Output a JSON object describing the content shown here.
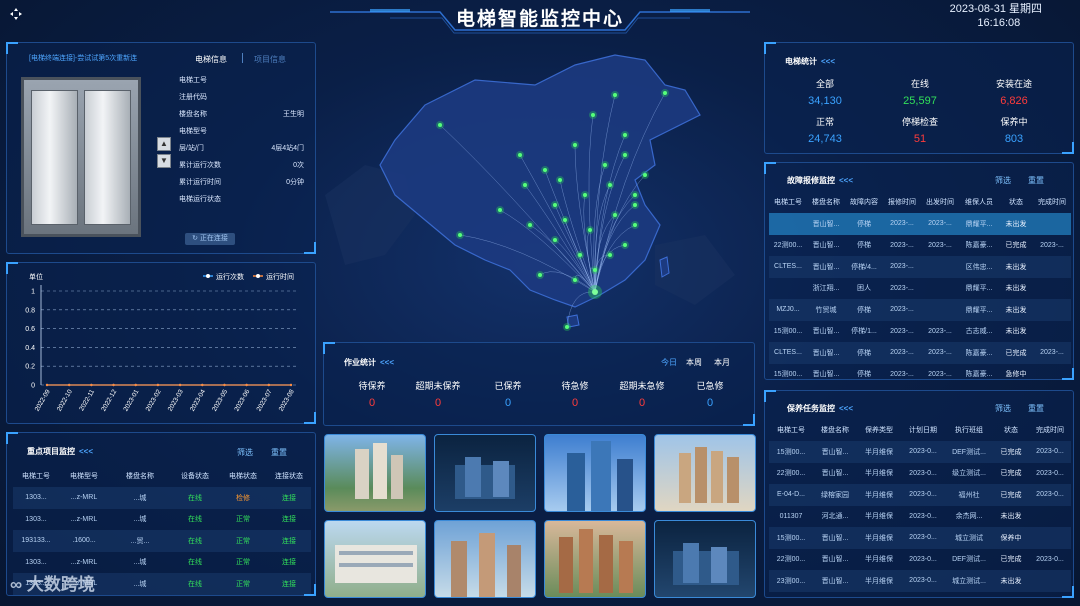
{
  "header": {
    "title": "电梯智能监控中心",
    "date": "2023-08-31 星期四",
    "time": "16:16:08"
  },
  "elevator": {
    "status_msg": "[电梯终端连接]-尝试试第5次重新连",
    "tabs": [
      "电梯信息",
      "项目信息"
    ],
    "fields": [
      {
        "label": "电梯工号",
        "value": ""
      },
      {
        "label": "注册代码",
        "value": ""
      },
      {
        "label": "楼盘名称",
        "value": "王生明"
      },
      {
        "label": "电梯型号",
        "value": ""
      },
      {
        "label": "层/站/门",
        "value": "4层4站4门"
      },
      {
        "label": "累计运行次数",
        "value": "0次"
      },
      {
        "label": "累计运行时间",
        "value": "0分钟"
      },
      {
        "label": "电梯运行状态",
        "value": ""
      }
    ],
    "button": "正在连接"
  },
  "chart_data": {
    "type": "line",
    "ylabel": "单位",
    "categories": [
      "2022-09",
      "2022-10",
      "2022-11",
      "2022-12",
      "2023-01",
      "2023-02",
      "2023-03",
      "2023-04",
      "2023-05",
      "2023-06",
      "2023-07",
      "2023-08"
    ],
    "series": [
      {
        "name": "运行次数",
        "values": [
          0,
          0,
          0,
          0,
          0,
          0,
          0,
          0,
          0,
          0,
          0,
          0
        ],
        "color": "#3aa2ff"
      },
      {
        "name": "运行时间",
        "values": [
          0,
          0,
          0,
          0,
          0,
          0,
          0,
          0,
          0,
          0,
          0,
          0
        ],
        "color": "#ff8a3d"
      }
    ],
    "yticks": [
      0,
      0.2,
      0.4,
      0.6,
      0.8,
      1
    ],
    "ylim": [
      0,
      1
    ]
  },
  "key_projects": {
    "title": "重点项目监控",
    "arrows": "<<<",
    "filter": "筛选",
    "reset": "重置",
    "headers": [
      "电梯工号",
      "电梯型号",
      "楼盘名称",
      "设备状态",
      "电梯状态",
      "连接状态"
    ],
    "rows": [
      [
        "1303...",
        "...z-MRL",
        "...城",
        "在线",
        "检修",
        "连接"
      ],
      [
        "1303...",
        "...z-MRL",
        "...城",
        "在线",
        "正常",
        "连接"
      ],
      [
        "193133...",
        ".1600...",
        "...贸...",
        "在线",
        "正常",
        "连接"
      ],
      [
        "1303...",
        "...z-MRL",
        "...城",
        "在线",
        "正常",
        "连接"
      ],
      [
        "1303...",
        "...z-MRL",
        "...城",
        "在线",
        "正常",
        "连接"
      ]
    ]
  },
  "work_stats": {
    "title": "作业统计",
    "arrows": "<<<",
    "periods": [
      "今日",
      "本周",
      "本月"
    ],
    "items": [
      {
        "label": "待保养",
        "value": "0",
        "color": "#ff3b3b"
      },
      {
        "label": "超期未保养",
        "value": "0",
        "color": "#ff3b3b"
      },
      {
        "label": "已保养",
        "value": "0",
        "color": "#3aa2ff"
      },
      {
        "label": "待急修",
        "value": "0",
        "color": "#ff3b3b"
      },
      {
        "label": "超期未急修",
        "value": "0",
        "color": "#ff3b3b"
      },
      {
        "label": "已急修",
        "value": "0",
        "color": "#3aa2ff"
      }
    ]
  },
  "elevator_stats": {
    "title": "电梯统计",
    "arrows": "<<<",
    "items": [
      {
        "label": "全部",
        "value": "34,130",
        "color": "#3aa2ff"
      },
      {
        "label": "在线",
        "value": "25,597",
        "color": "#32e05a"
      },
      {
        "label": "安装在途",
        "value": "6,826",
        "color": "#ff3b3b"
      },
      {
        "label": "正常",
        "value": "24,743",
        "color": "#3aa2ff"
      },
      {
        "label": "停梯检查",
        "value": "51",
        "color": "#ff3b3b"
      },
      {
        "label": "保养中",
        "value": "803",
        "color": "#3aa2ff"
      }
    ]
  },
  "fault_monitor": {
    "title": "故障报修监控",
    "arrows": "<<<",
    "filter": "筛选",
    "reset": "重置",
    "headers": [
      "电梯工号",
      "楼盘名称",
      "故障内容",
      "报修时间",
      "出发时间",
      "维保人员",
      "状态",
      "完成时间"
    ],
    "rows": [
      [
        "",
        "晋山智...",
        "停梯",
        "2023-...",
        "2023-...",
        "鼎耀平...",
        "未出发",
        ""
      ],
      [
        "22测00...",
        "晋山智...",
        "停梯",
        "2023-...",
        "2023-...",
        "陈嘉豪...",
        "已完成",
        "2023-..."
      ],
      [
        "CLTES...",
        "晋山智...",
        "停梯/4...",
        "2023-...",
        "",
        "区伟忠...",
        "未出发",
        ""
      ],
      [
        "",
        "浙江翔...",
        "困人",
        "2023-...",
        "",
        "鼎耀平...",
        "未出发",
        ""
      ],
      [
        "MZJ0...",
        "竹贸城",
        "停梯",
        "2023-...",
        "",
        "鼎耀平...",
        "未出发",
        ""
      ],
      [
        "15测00...",
        "晋山智...",
        "停梯/1...",
        "2023-...",
        "2023-...",
        "古志威...",
        "未出发",
        ""
      ],
      [
        "CLTES...",
        "晋山智...",
        "停梯",
        "2023-...",
        "2023-...",
        "陈嘉豪...",
        "已完成",
        "2023-..."
      ],
      [
        "15测00...",
        "晋山智...",
        "停梯",
        "2023-...",
        "2023-...",
        "陈嘉豪...",
        "急修中",
        ""
      ]
    ]
  },
  "maint_monitor": {
    "title": "保养任务监控",
    "arrows": "<<<",
    "filter": "筛选",
    "reset": "重置",
    "headers": [
      "电梯工号",
      "楼盘名称",
      "保养类型",
      "计划日期",
      "执行班组",
      "状态",
      "完成时间"
    ],
    "rows": [
      [
        "15测00...",
        "晋山智...",
        "半月维保",
        "2023-0...",
        "DEF测试...",
        "已完成",
        "2023-0..."
      ],
      [
        "22测00...",
        "晋山智...",
        "半月维保",
        "2023-0...",
        "级立测试...",
        "已完成",
        "2023-0..."
      ],
      [
        "E-04-D...",
        "绿榕家园",
        "半月维保",
        "2023-0...",
        "福州社",
        "已完成",
        "2023-0..."
      ],
      [
        "011307",
        "河北通...",
        "半月维保",
        "2023-0...",
        "余杰网...",
        "未出发",
        ""
      ],
      [
        "15测00...",
        "晋山智...",
        "半月维保",
        "2023-0...",
        "城立测试",
        "保养中",
        ""
      ],
      [
        "22测00...",
        "晋山智...",
        "半月维保",
        "2023-0...",
        "DEF测试...",
        "已完成",
        "2023-0..."
      ],
      [
        "23测00...",
        "晋山智...",
        "半月维保",
        "2023-0...",
        "城立测试...",
        "未出发",
        ""
      ]
    ]
  },
  "watermark": "大数跨境"
}
